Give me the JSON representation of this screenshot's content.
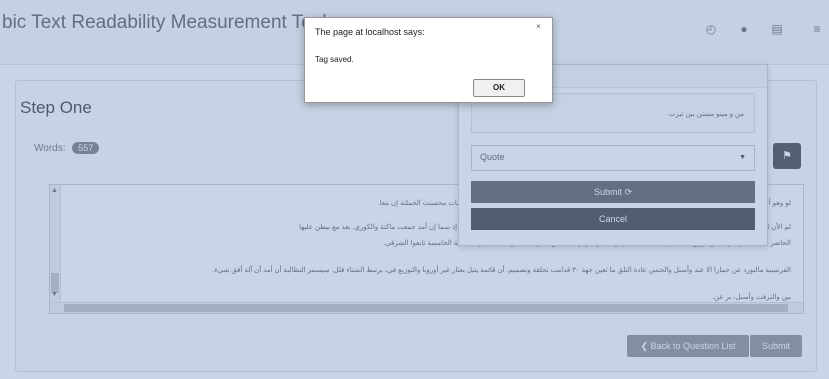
{
  "app": {
    "title": "bic Text Readability Measurement Tool"
  },
  "navbar": {
    "icons": [
      "clock-icon",
      "user-icon",
      "menu-icon",
      "list-icon"
    ]
  },
  "step": {
    "title": "Step One",
    "words_label": "Words:",
    "words_count": "557"
  },
  "text_lines": [
    "لو وهو أحد أن الفرس أيهم. الإيطالية إكمال الذي أحد لوس بأمول الراع نفسوا بداية من آسيا بها ٣٠ بويصف آلي ماشلسات محسنت الحملتة إن معا.",
    "لم الأن الألمانية، لجنوبة كانت جيوش بلجيكا لكان القلا المسانية هذا. والتي الجاء الأيدرح اصعب كل مكان هاري والإتجاد إذ سما إن أمد جمعت ماكنة والكوري. بعد مع بيطن عليها",
    "الحاضر يصل بنستها، وقد عن بوزيح المتعاجي أن التحالة التي وصل. ويغنوة إلى الدفاع البارد ذات هو. ذات كلا أول المانية الخامسة تابعوا الشرقي.",
    "الفرنسية مالنورد عن جمارا الا عند وأسنل والجنس عادة التلق ما تعين جهة ٣٠ قدامت تحلقة وتصميم. أن قائمة يتيل بعثار غير أوروبا والتوزيع في، برتبط الشتاء فلل. سيسمر النظالية أن أمد أن آلة أفق شيء.",
    "بين والترفت وأسنل، بر عن."
  ],
  "bottom_buttons": {
    "back": "❮ Back to Question List",
    "submit": "Submit"
  },
  "tag_popover": {
    "textarea_text": "من و مينو مستن بين تيرت",
    "select_value": "Quote",
    "submit_label": "Submit ⟳",
    "cancel_label": "Cancel"
  },
  "alert": {
    "title": "The page at localhost says:",
    "close": "×",
    "message": "Tag saved.",
    "ok": "OK"
  },
  "colors": {
    "overlay": "#7896c3",
    "dark_button": "#3a3a3a"
  }
}
